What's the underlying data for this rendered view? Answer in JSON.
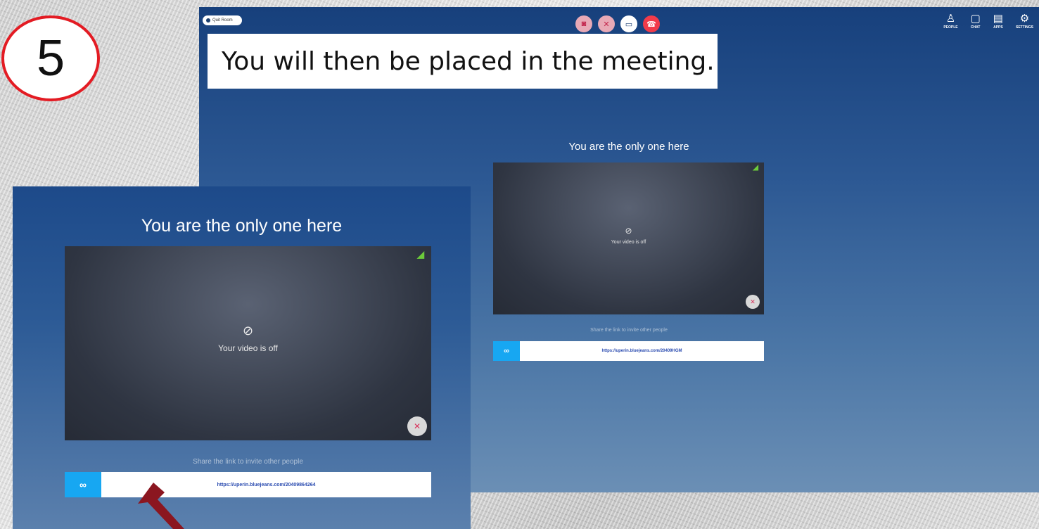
{
  "step_number": "5",
  "caption": "You will then be placed in the meeting.",
  "topbar": {
    "exit_label": "Quit Room",
    "controls": [
      {
        "name": "camera-button",
        "icon": "camera-off-icon",
        "glyph": "◙"
      },
      {
        "name": "mic-button",
        "icon": "mic-off-icon",
        "glyph": "✕"
      },
      {
        "name": "share-screen-button",
        "icon": "share-screen-icon",
        "glyph": "▭"
      },
      {
        "name": "end-call-button",
        "icon": "end-call-icon",
        "glyph": "☎"
      }
    ],
    "tools": [
      {
        "label": "PEOPLE",
        "icon": "people-icon",
        "glyph": "♙"
      },
      {
        "label": "CHAT",
        "icon": "chat-icon",
        "glyph": "▢"
      },
      {
        "label": "APPS",
        "icon": "apps-icon",
        "glyph": "▤"
      },
      {
        "label": "SETTINGS",
        "icon": "gear-icon",
        "glyph": "⚙"
      }
    ]
  },
  "meeting": {
    "title": "You are the only one here",
    "video_status": "Your video is off",
    "share_prompt": "Share the link to invite other people",
    "link_short": "https://uperin.bluejeans.com/20409HGM",
    "link_zoom": "https://uperin.bluejeans.com/20409864264"
  },
  "colors": {
    "accent_link": "#17a7f2",
    "end_call": "#f23b4a",
    "signal": "#6ccb3b",
    "step_circle": "#e31b23",
    "arrow": "#8b1620"
  }
}
